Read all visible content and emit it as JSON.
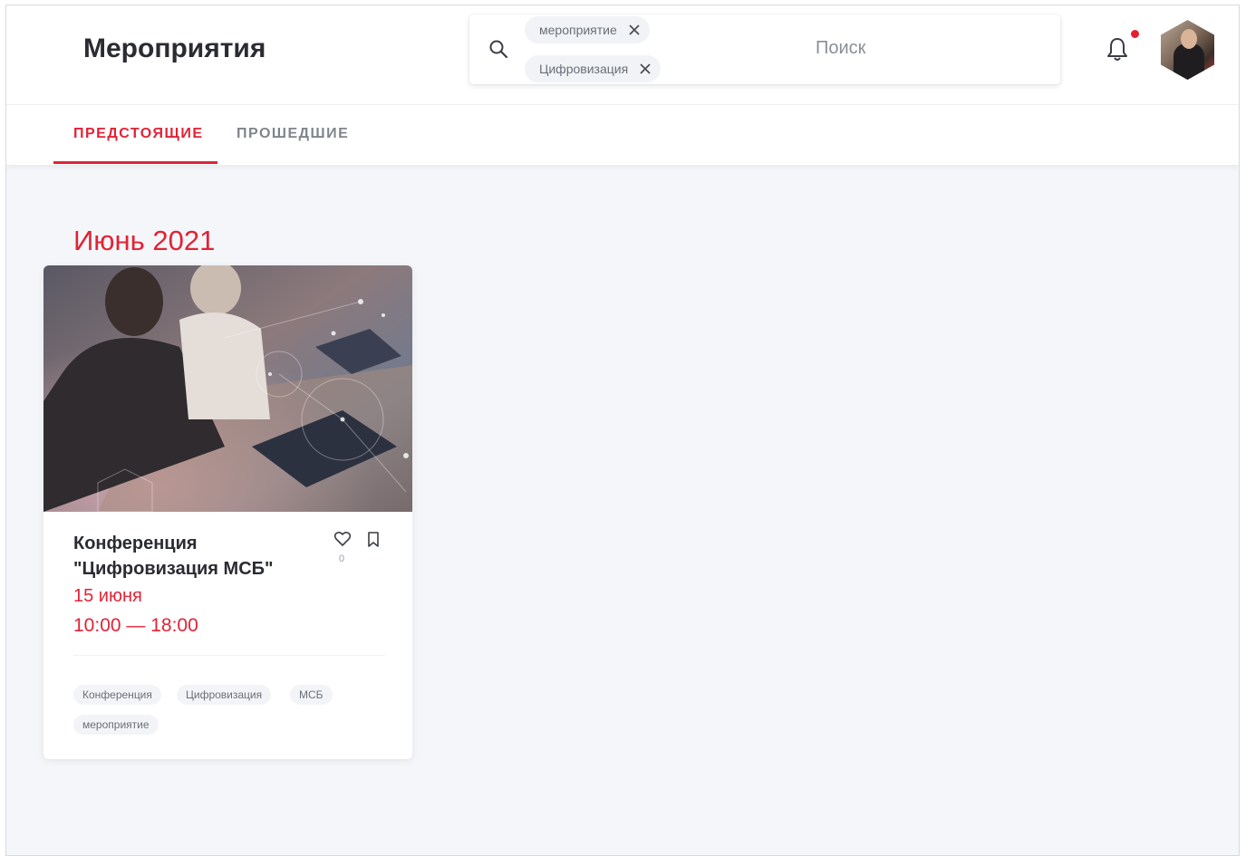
{
  "header": {
    "title": "Мероприятия",
    "search": {
      "placeholder": "Поиск",
      "chips": [
        "мероприятие",
        "Цифровизация"
      ]
    },
    "notification_dot_color": "#e4202f"
  },
  "tabs": [
    {
      "label": "ПРЕДСТОЯЩИЕ",
      "active": true
    },
    {
      "label": "ПРОШЕДШИЕ",
      "active": false
    }
  ],
  "accent_color": "#e22236",
  "month_heading": "Июнь 2021",
  "events": [
    {
      "title": "Конференция \"Цифровизация МСБ\"",
      "date": "15 июня",
      "time": "10:00 — 18:00",
      "likes": "0",
      "tags": [
        "Конференция",
        "Цифровизация",
        "МСБ",
        "мероприятие"
      ]
    }
  ]
}
